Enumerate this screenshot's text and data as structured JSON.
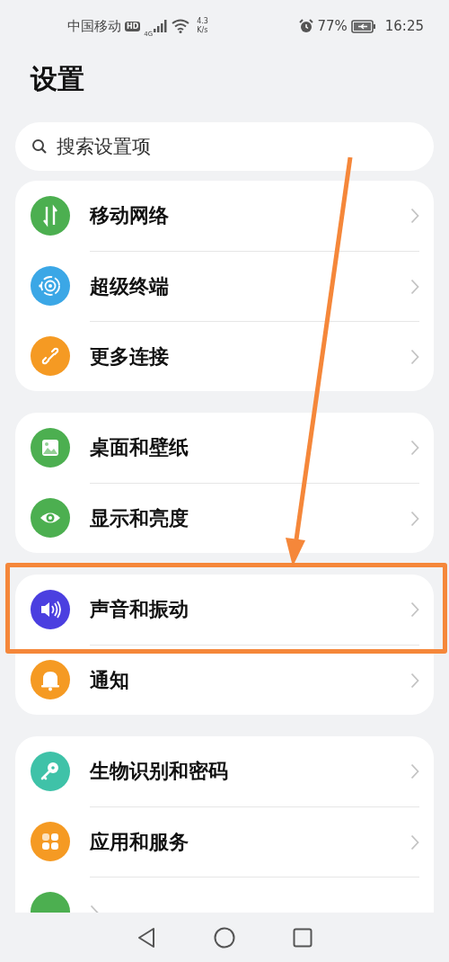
{
  "status_bar": {
    "carrier": "中国移动",
    "hd_badge": "HD",
    "network": "4G",
    "speed_value": "4.3",
    "speed_unit": "K/s",
    "alarm": true,
    "battery_percent": "77%",
    "battery_charging": true,
    "time": "16:25"
  },
  "title": "设置",
  "search": {
    "placeholder": "搜索设置项"
  },
  "groups": [
    {
      "items": [
        {
          "label": "移动网络",
          "kind": "arrows",
          "color": "#4caf50",
          "highlighted": false
        },
        {
          "label": "超级终端",
          "kind": "orbit",
          "color": "#3ba7e6",
          "highlighted": false
        },
        {
          "label": "更多连接",
          "kind": "link",
          "color": "#f59a23",
          "highlighted": false
        }
      ]
    },
    {
      "items": [
        {
          "label": "桌面和壁纸",
          "kind": "image",
          "color": "#4caf50",
          "highlighted": false
        },
        {
          "label": "显示和亮度",
          "kind": "eye",
          "color": "#4caf50",
          "highlighted": false
        }
      ]
    },
    {
      "items": [
        {
          "label": "声音和振动",
          "kind": "speaker",
          "color": "#4b3fe0",
          "highlighted": true
        },
        {
          "label": "通知",
          "kind": "bell",
          "color": "#f59a23",
          "highlighted": false
        }
      ]
    },
    {
      "items": [
        {
          "label": "生物识别和密码",
          "kind": "key",
          "color": "#3fc2a8",
          "highlighted": false
        },
        {
          "label": "应用和服务",
          "kind": "apps",
          "color": "#f59a23",
          "highlighted": false
        },
        {
          "kind": "blank",
          "color": "#4caf50"
        }
      ]
    }
  ],
  "annotation": {
    "arrow": true,
    "color": "#f5873a"
  }
}
